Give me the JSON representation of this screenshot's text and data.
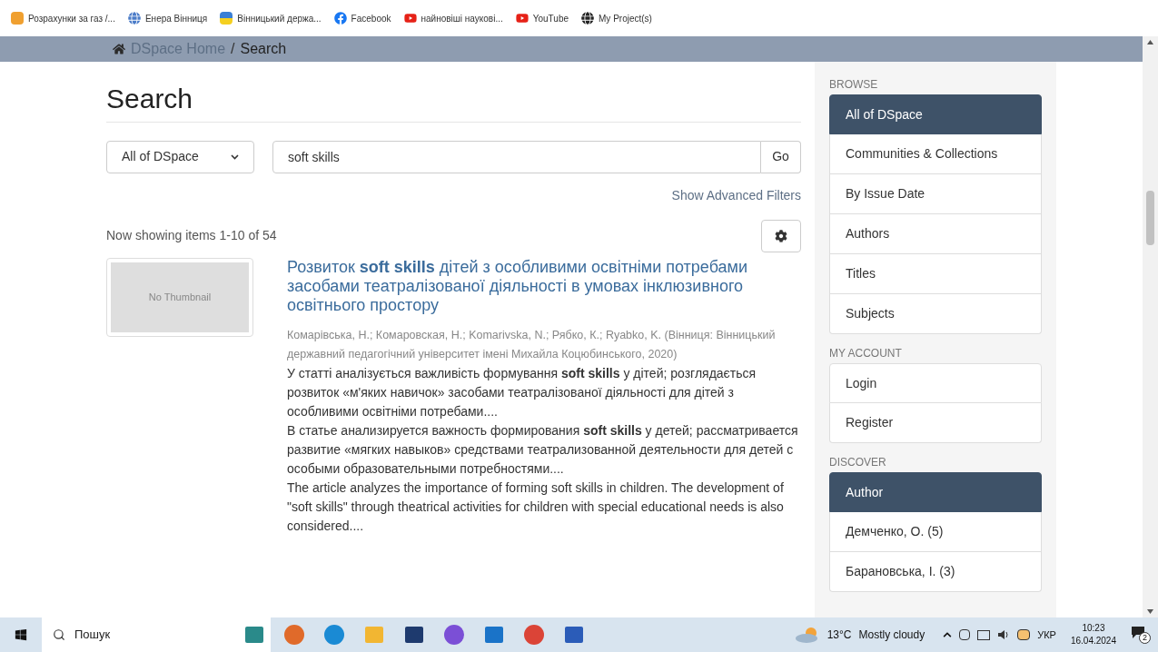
{
  "bookmarks": [
    "Розрахунки за газ /...",
    "Енера Вінниця",
    "Вінницький держа...",
    "Facebook",
    "найновіші наукові...",
    "YouTube",
    "My Project(s)"
  ],
  "breadcrumb": {
    "home": "DSpace Home",
    "separator": "/",
    "current": "Search"
  },
  "page_title": "Search",
  "search": {
    "scope": "All of DSpace",
    "query": "soft skills",
    "go": "Go",
    "advanced": "Show Advanced Filters"
  },
  "results_summary": "Now showing items 1-10 of 54",
  "results": [
    {
      "thumbnail": "No Thumbnail",
      "title": "Розвиток **soft skills** дітей з особливими освітніми потребами засобами театралізованої діяльності в умовах інклюзивного освітнього простору",
      "authors": "Комарівська, Н.; Комаровская, Н.; Komarivska, N.; Рябко, К.; Ryabko, K. (Вінниця: Вінницький державний педагогічний університет імені Михайла Коцюбинського, 2020)",
      "abstract": [
        "У статті аналізується важливість формування **soft skills** у дітей; розглядається розвиток «м'яких навичок» засобами театралізованої діяльності для дітей з особливими освітніми потребами....",
        "В статье анализируется важность формирования **soft skills** у детей; рассматривается развитие «мягких навыков» средствами театрализованной деятельности для детей с особыми образовательными потребностями....",
        "The article analyzes the importance of forming soft skills in children. The development of \"soft skills\" through theatrical activities for children with special educational needs is also considered...."
      ]
    }
  ],
  "sidebar": [
    {
      "heading": "BROWSE",
      "items": [
        {
          "label": "All of DSpace",
          "selected": true
        },
        {
          "label": "Communities & Collections",
          "selected": false
        },
        {
          "label": "By Issue Date",
          "selected": false
        },
        {
          "label": "Authors",
          "selected": false
        },
        {
          "label": "Titles",
          "selected": false
        },
        {
          "label": "Subjects",
          "selected": false
        }
      ]
    },
    {
      "heading": "MY ACCOUNT",
      "items": [
        {
          "label": "Login",
          "selected": false
        },
        {
          "label": "Register",
          "selected": false
        }
      ]
    },
    {
      "heading": "DISCOVER",
      "items": [
        {
          "label": "Author",
          "selected": true
        },
        {
          "label": "Демченко, О. (5)",
          "selected": false
        },
        {
          "label": "Барановська, І. (3)",
          "selected": false
        }
      ]
    }
  ],
  "taskbar": {
    "search_placeholder": "Пошук",
    "weather": "13°C",
    "weather_text": "Mostly cloudy",
    "language": "УКР",
    "time": "10:23",
    "date": "16.04.2024",
    "notifications": "2"
  }
}
